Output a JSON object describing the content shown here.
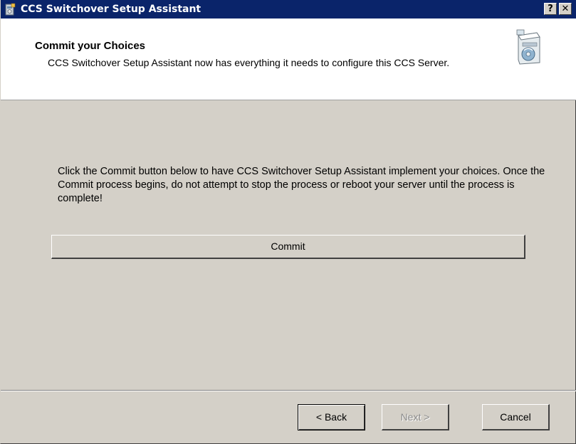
{
  "window": {
    "title": "CCS Switchover Setup Assistant",
    "help_label": "?",
    "close_label": "✕"
  },
  "header": {
    "title": "Commit your Choices",
    "description": "CCS Switchover Setup Assistant now has everything it needs to configure this CCS Server."
  },
  "body": {
    "instructions": "Click the Commit button below to have CCS Switchover Setup Assistant implement your choices. Once the Commit process begins, do not attempt to stop the process or reboot your server until the process is complete!",
    "commit_label": "Commit"
  },
  "footer": {
    "back_label": "< Back",
    "next_label": "Next >",
    "cancel_label": "Cancel"
  },
  "colors": {
    "titlebar": "#0a246a",
    "dialog_face": "#d4d0c8",
    "header_background": "#ffffff",
    "disabled_text": "#8c8c8c"
  },
  "icons": {
    "title_icon": "setup-assistant-icon",
    "header_icon": "server-cd-box-icon"
  }
}
